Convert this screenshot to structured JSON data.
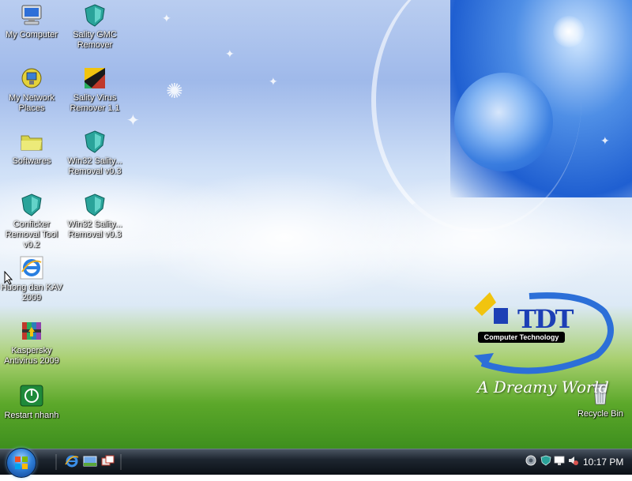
{
  "desktop_icons": [
    {
      "label": "My Computer",
      "icon": "my-computer-icon"
    },
    {
      "label": "Sality GMC\nRemover",
      "icon": "shield-icon"
    },
    {
      "label": "My Network\nPlaces",
      "icon": "network-places-icon"
    },
    {
      "label": "Sality Virus\nRemover 1.1",
      "icon": "sality-remover-icon"
    },
    {
      "label": "Softwares",
      "icon": "folder-icon"
    },
    {
      "label": "Win32 Sality...\nRemoval v0.3",
      "icon": "shield-icon"
    },
    {
      "label": "Conficker\nRemoval Tool\nv0.2",
      "icon": "shield-icon"
    },
    {
      "label": "Win32 Sality...\nRemoval v0.3",
      "icon": "shield-icon"
    },
    {
      "label": "Huong dan KAV\n2009",
      "icon": "internet-explorer-icon"
    },
    {
      "label": "Kaspersky\nAntivirus 2009",
      "icon": "archive-icon"
    },
    {
      "label": "Restart nhanh",
      "icon": "power-icon"
    },
    {
      "label": "Recycle Bin",
      "icon": "recycle-bin-icon"
    }
  ],
  "wallpaper": {
    "brand_main": "TDT",
    "brand_sub": "Computer Technology",
    "tagline": "A Dreamy World"
  },
  "taskbar": {
    "quick_launch": [
      "internet-explorer-icon",
      "show-desktop-icon",
      "switch-windows-icon"
    ],
    "tray_icons": [
      "network-icon",
      "security-shield-icon",
      "monitor-icon",
      "volume-icon"
    ],
    "clock": "10:17 PM"
  }
}
